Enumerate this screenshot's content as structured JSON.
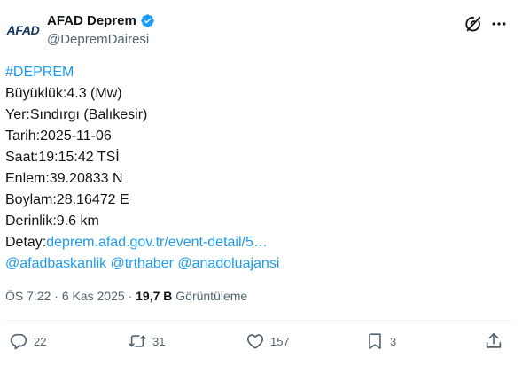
{
  "author": {
    "avatar_text": "AFAD",
    "display_name": "AFAD Deprem",
    "handle": "@DepremDairesi"
  },
  "body": {
    "hashtag": "#DEPREM",
    "lines": [
      "Büyüklük:4.3 (Mw)",
      "Yer:Sındırgı (Balıkesir)",
      "Tarih:2025-11-06",
      "Saat:19:15:42 TSİ",
      "Enlem:39.20833 N",
      "Boylam:28.16472 E",
      "Derinlik:9.6 km"
    ],
    "detail_label": "Detay:",
    "detail_link": "deprem.afad.gov.tr/event-detail/5…",
    "mentions": [
      "@afadbaskanlik",
      "@trthaber",
      "@anadoluajansi"
    ]
  },
  "meta": {
    "time": "ÖS 7:22",
    "separator": " · ",
    "date": "6 Kas 2025",
    "views_count": "19,7 B",
    "views_label": "Görüntüleme"
  },
  "actions": {
    "replies": "22",
    "reposts": "31",
    "likes": "157",
    "bookmarks": "3"
  },
  "colors": {
    "link": "#1d9bf0",
    "verified": "#1d9bf0",
    "secondary_text": "#536471",
    "primary_text": "#0f1419"
  },
  "icons": [
    "verified-badge-icon",
    "grok-icon",
    "more-icon",
    "reply-icon",
    "repost-icon",
    "like-icon",
    "bookmark-icon",
    "share-icon"
  ]
}
